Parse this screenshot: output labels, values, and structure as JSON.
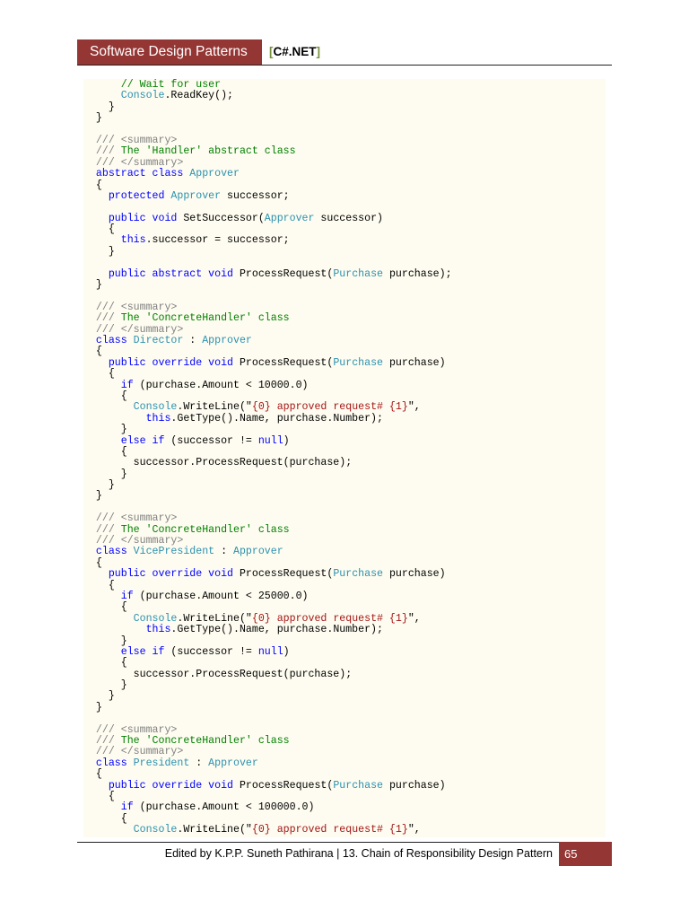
{
  "header": {
    "title": "Software Design Patterns",
    "tag_open": "[",
    "tag": "C#.NET",
    "tag_close": "]"
  },
  "footer": {
    "text": "Edited by K.P.P. Suneth Pathirana | 13. Chain of Responsibility Design Pattern",
    "page_number": "65"
  },
  "colors": {
    "accent": "#943634",
    "bracket": "#76923c",
    "keyword": "#0000ff",
    "type": "#2b91af",
    "comment": "#008000",
    "doc": "#808080",
    "string": "#a31515",
    "code_bg": "#fefcf0"
  },
  "code_lines": [
    [
      [
        "p",
        "      "
      ],
      [
        "c",
        "// Wait for user"
      ]
    ],
    [
      [
        "p",
        "      "
      ],
      [
        "t",
        "Console"
      ],
      [
        "p",
        ".ReadKey();"
      ]
    ],
    [
      [
        "p",
        "    }"
      ]
    ],
    [
      [
        "p",
        "  }"
      ]
    ],
    [],
    [
      [
        "p",
        "  "
      ],
      [
        "d",
        "/// <summary>"
      ]
    ],
    [
      [
        "p",
        "  "
      ],
      [
        "d",
        "///"
      ],
      [
        "c",
        " The 'Handler' abstract class"
      ]
    ],
    [
      [
        "p",
        "  "
      ],
      [
        "d",
        "/// </summary>"
      ]
    ],
    [
      [
        "p",
        "  "
      ],
      [
        "k",
        "abstract class "
      ],
      [
        "t",
        "Approver"
      ]
    ],
    [
      [
        "p",
        "  {"
      ]
    ],
    [
      [
        "p",
        "    "
      ],
      [
        "k",
        "protected "
      ],
      [
        "t",
        "Approver"
      ],
      [
        "p",
        " successor;"
      ]
    ],
    [],
    [
      [
        "p",
        "    "
      ],
      [
        "k",
        "public void "
      ],
      [
        "p",
        "SetSuccessor("
      ],
      [
        "t",
        "Approver"
      ],
      [
        "p",
        " successor)"
      ]
    ],
    [
      [
        "p",
        "    {"
      ]
    ],
    [
      [
        "p",
        "      "
      ],
      [
        "k",
        "this"
      ],
      [
        "p",
        ".successor = successor;"
      ]
    ],
    [
      [
        "p",
        "    }"
      ]
    ],
    [],
    [
      [
        "p",
        "    "
      ],
      [
        "k",
        "public abstract void "
      ],
      [
        "p",
        "ProcessRequest("
      ],
      [
        "t",
        "Purchase"
      ],
      [
        "p",
        " purchase);"
      ]
    ],
    [
      [
        "p",
        "  }"
      ]
    ],
    [],
    [
      [
        "p",
        "  "
      ],
      [
        "d",
        "/// <summary>"
      ]
    ],
    [
      [
        "p",
        "  "
      ],
      [
        "d",
        "///"
      ],
      [
        "c",
        " The 'ConcreteHandler' class"
      ]
    ],
    [
      [
        "p",
        "  "
      ],
      [
        "d",
        "/// </summary>"
      ]
    ],
    [
      [
        "p",
        "  "
      ],
      [
        "k",
        "class "
      ],
      [
        "t",
        "Director"
      ],
      [
        "p",
        " : "
      ],
      [
        "t",
        "Approver"
      ]
    ],
    [
      [
        "p",
        "  {"
      ]
    ],
    [
      [
        "p",
        "    "
      ],
      [
        "k",
        "public override void "
      ],
      [
        "p",
        "ProcessRequest("
      ],
      [
        "t",
        "Purchase"
      ],
      [
        "p",
        " purchase)"
      ]
    ],
    [
      [
        "p",
        "    {"
      ]
    ],
    [
      [
        "p",
        "      "
      ],
      [
        "k",
        "if"
      ],
      [
        "p",
        " (purchase.Amount < 10000.0)"
      ]
    ],
    [
      [
        "p",
        "      {"
      ]
    ],
    [
      [
        "p",
        "        "
      ],
      [
        "t",
        "Console"
      ],
      [
        "p",
        ".WriteLine(\""
      ],
      [
        "s",
        "{0} approved request# {1}"
      ],
      [
        "p",
        "\","
      ]
    ],
    [
      [
        "p",
        "          "
      ],
      [
        "k",
        "this"
      ],
      [
        "p",
        ".GetType().Name, purchase.Number);"
      ]
    ],
    [
      [
        "p",
        "      }"
      ]
    ],
    [
      [
        "p",
        "      "
      ],
      [
        "k",
        "else if"
      ],
      [
        "p",
        " (successor != "
      ],
      [
        "k",
        "null"
      ],
      [
        "p",
        ")"
      ]
    ],
    [
      [
        "p",
        "      {"
      ]
    ],
    [
      [
        "p",
        "        successor.ProcessRequest(purchase);"
      ]
    ],
    [
      [
        "p",
        "      }"
      ]
    ],
    [
      [
        "p",
        "    }"
      ]
    ],
    [
      [
        "p",
        "  }"
      ]
    ],
    [],
    [
      [
        "p",
        "  "
      ],
      [
        "d",
        "/// <summary>"
      ]
    ],
    [
      [
        "p",
        "  "
      ],
      [
        "d",
        "///"
      ],
      [
        "c",
        " The 'ConcreteHandler' class"
      ]
    ],
    [
      [
        "p",
        "  "
      ],
      [
        "d",
        "/// </summary>"
      ]
    ],
    [
      [
        "p",
        "  "
      ],
      [
        "k",
        "class "
      ],
      [
        "t",
        "VicePresident"
      ],
      [
        "p",
        " : "
      ],
      [
        "t",
        "Approver"
      ]
    ],
    [
      [
        "p",
        "  {"
      ]
    ],
    [
      [
        "p",
        "    "
      ],
      [
        "k",
        "public override void "
      ],
      [
        "p",
        "ProcessRequest("
      ],
      [
        "t",
        "Purchase"
      ],
      [
        "p",
        " purchase)"
      ]
    ],
    [
      [
        "p",
        "    {"
      ]
    ],
    [
      [
        "p",
        "      "
      ],
      [
        "k",
        "if"
      ],
      [
        "p",
        " (purchase.Amount < 25000.0)"
      ]
    ],
    [
      [
        "p",
        "      {"
      ]
    ],
    [
      [
        "p",
        "        "
      ],
      [
        "t",
        "Console"
      ],
      [
        "p",
        ".WriteLine(\""
      ],
      [
        "s",
        "{0} approved request# {1}"
      ],
      [
        "p",
        "\","
      ]
    ],
    [
      [
        "p",
        "          "
      ],
      [
        "k",
        "this"
      ],
      [
        "p",
        ".GetType().Name, purchase.Number);"
      ]
    ],
    [
      [
        "p",
        "      }"
      ]
    ],
    [
      [
        "p",
        "      "
      ],
      [
        "k",
        "else if"
      ],
      [
        "p",
        " (successor != "
      ],
      [
        "k",
        "null"
      ],
      [
        "p",
        ")"
      ]
    ],
    [
      [
        "p",
        "      {"
      ]
    ],
    [
      [
        "p",
        "        successor.ProcessRequest(purchase);"
      ]
    ],
    [
      [
        "p",
        "      }"
      ]
    ],
    [
      [
        "p",
        "    }"
      ]
    ],
    [
      [
        "p",
        "  }"
      ]
    ],
    [],
    [
      [
        "p",
        "  "
      ],
      [
        "d",
        "/// <summary>"
      ]
    ],
    [
      [
        "p",
        "  "
      ],
      [
        "d",
        "///"
      ],
      [
        "c",
        " The 'ConcreteHandler' class"
      ]
    ],
    [
      [
        "p",
        "  "
      ],
      [
        "d",
        "/// </summary>"
      ]
    ],
    [
      [
        "p",
        "  "
      ],
      [
        "k",
        "class "
      ],
      [
        "t",
        "President"
      ],
      [
        "p",
        " : "
      ],
      [
        "t",
        "Approver"
      ]
    ],
    [
      [
        "p",
        "  {"
      ]
    ],
    [
      [
        "p",
        "    "
      ],
      [
        "k",
        "public override void "
      ],
      [
        "p",
        "ProcessRequest("
      ],
      [
        "t",
        "Purchase"
      ],
      [
        "p",
        " purchase)"
      ]
    ],
    [
      [
        "p",
        "    {"
      ]
    ],
    [
      [
        "p",
        "      "
      ],
      [
        "k",
        "if"
      ],
      [
        "p",
        " (purchase.Amount < 100000.0)"
      ]
    ],
    [
      [
        "p",
        "      {"
      ]
    ],
    [
      [
        "p",
        "        "
      ],
      [
        "t",
        "Console"
      ],
      [
        "p",
        ".WriteLine(\""
      ],
      [
        "s",
        "{0} approved request# {1}"
      ],
      [
        "p",
        "\","
      ]
    ]
  ]
}
